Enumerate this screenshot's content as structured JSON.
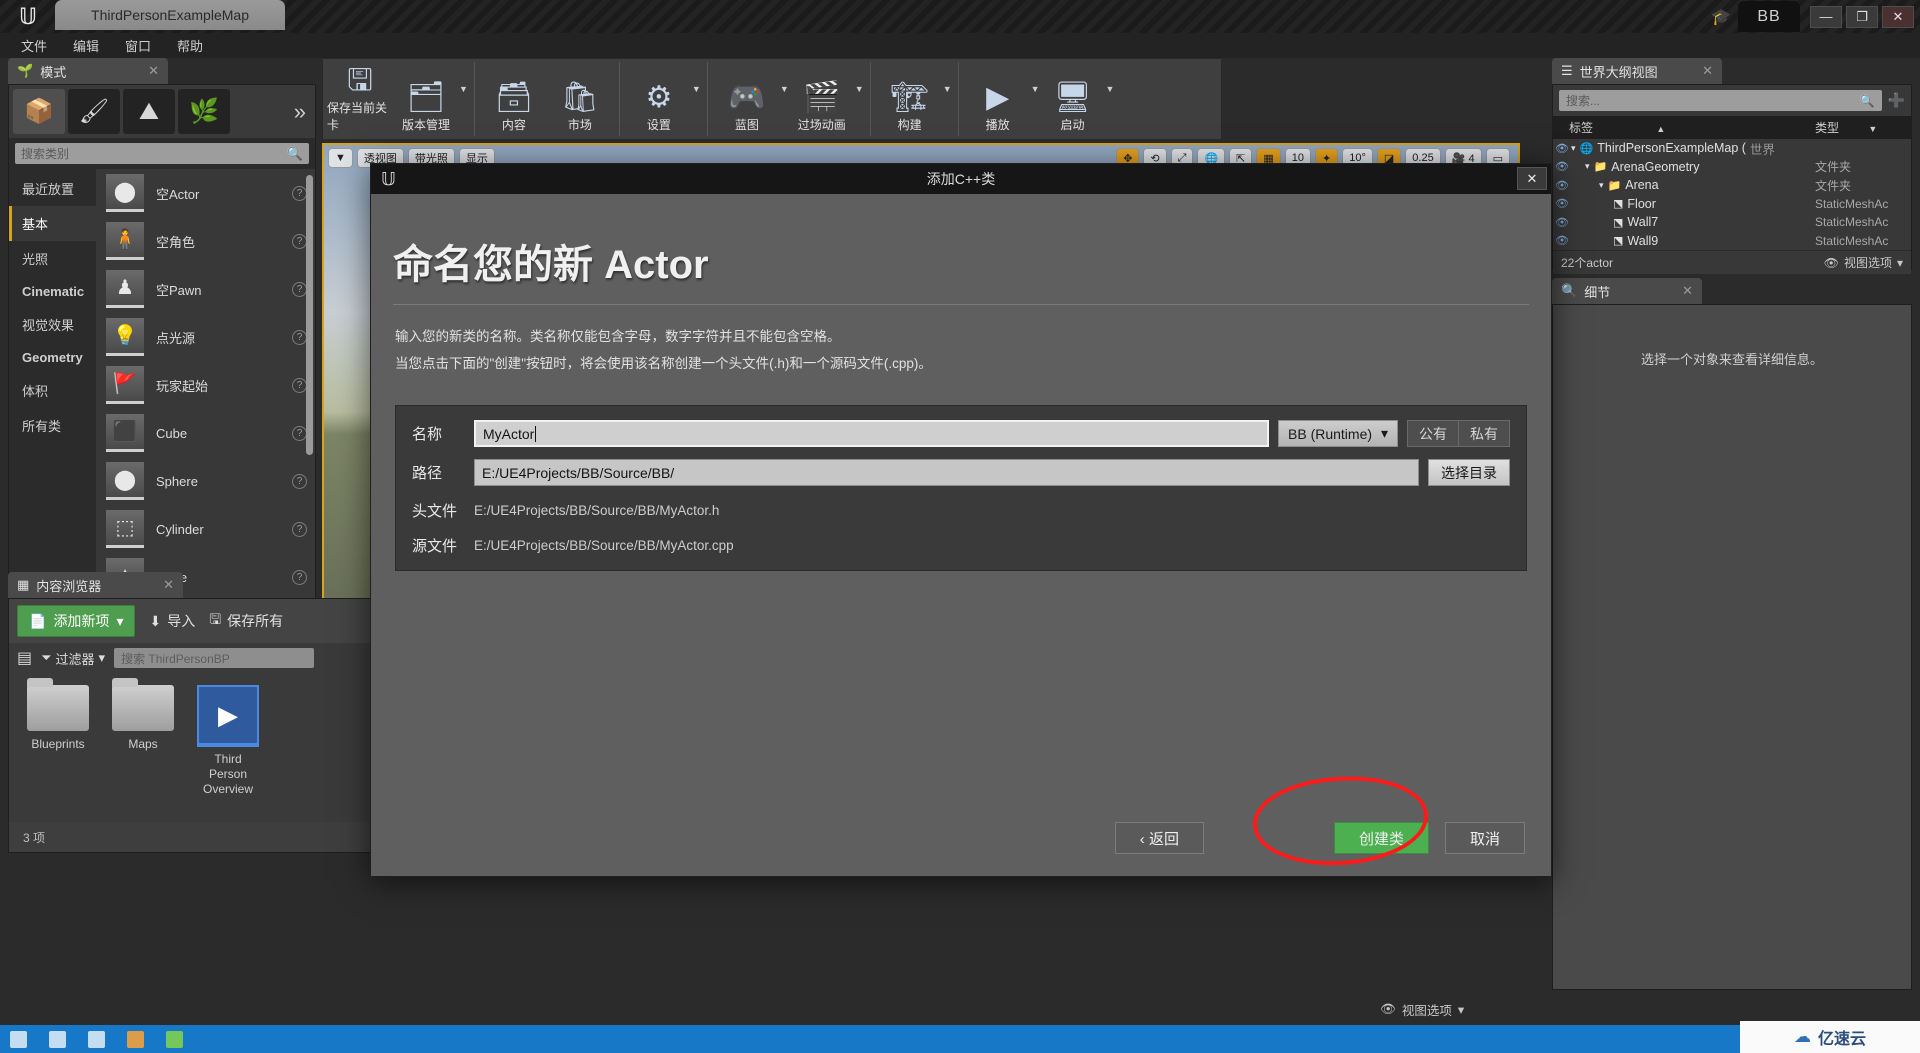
{
  "titlebar": {
    "logo": "ue-logo",
    "map_tab": "ThirdPersonExampleMap",
    "project_badge": "BB",
    "minimize": "—",
    "maximize": "❐",
    "close": "✕"
  },
  "menubar": {
    "items": [
      {
        "label": "文件"
      },
      {
        "label": "编辑"
      },
      {
        "label": "窗口"
      },
      {
        "label": "帮助"
      }
    ]
  },
  "toolbar": {
    "groups": [
      {
        "items": [
          {
            "label": "保存当前关卡",
            "icon": "save-icon",
            "glyph": "🖫",
            "caret": false
          },
          {
            "label": "版本管理",
            "icon": "source-control-icon",
            "glyph": "🗂",
            "caret": true
          }
        ]
      },
      {
        "items": [
          {
            "label": "内容",
            "icon": "content-icon",
            "glyph": "🗃",
            "caret": false
          },
          {
            "label": "市场",
            "icon": "marketplace-icon",
            "glyph": "🛍",
            "caret": false
          }
        ]
      },
      {
        "items": [
          {
            "label": "设置",
            "icon": "settings-gear-icon",
            "glyph": "⚙",
            "caret": true
          }
        ]
      },
      {
        "items": [
          {
            "label": "蓝图",
            "icon": "blueprint-icon",
            "glyph": "🎮",
            "caret": true
          },
          {
            "label": "过场动画",
            "icon": "cinematics-icon",
            "glyph": "🎬",
            "caret": true
          }
        ]
      },
      {
        "items": [
          {
            "label": "构建",
            "icon": "build-icon",
            "glyph": "🏗",
            "caret": true
          }
        ]
      },
      {
        "items": [
          {
            "label": "播放",
            "icon": "play-icon",
            "glyph": "▶",
            "caret": true
          },
          {
            "label": "启动",
            "icon": "launch-icon",
            "glyph": "🖥",
            "caret": true
          }
        ]
      }
    ]
  },
  "viewport": {
    "chips": [
      {
        "name": "viewport-menu",
        "label": "▼"
      },
      {
        "name": "perspective",
        "label": "透视图"
      },
      {
        "name": "lighting",
        "label": "带光照"
      },
      {
        "name": "show",
        "label": "显示"
      }
    ],
    "right_chips": [
      {
        "name": "translate-mode",
        "label": "✥",
        "active": true
      },
      {
        "name": "rotate-mode",
        "label": "⟲",
        "active": false
      },
      {
        "name": "scale-mode",
        "label": "⤢",
        "active": false
      },
      {
        "name": "coord-system",
        "label": "🌐",
        "active": false
      },
      {
        "name": "surface-snap",
        "label": "⇱",
        "active": false
      },
      {
        "name": "grid-snap",
        "label": "▦",
        "active": true
      },
      {
        "name": "grid-size",
        "label": "10",
        "active": false
      },
      {
        "name": "rotation-snap",
        "label": "✦",
        "active": true
      },
      {
        "name": "rotation-value",
        "label": "10°",
        "active": false
      },
      {
        "name": "scale-snap",
        "label": "◪",
        "active": true
      },
      {
        "name": "scale-value",
        "label": "0.25",
        "active": false
      },
      {
        "name": "camera-speed",
        "label": "🎥 4",
        "active": false
      },
      {
        "name": "maximize-viewport",
        "label": "▭",
        "active": false
      }
    ]
  },
  "modes_panel": {
    "tab_title": "模式",
    "tab_close": "✕",
    "mode_buttons": [
      {
        "name": "place-mode",
        "glyph": "📦",
        "active": true
      },
      {
        "name": "paint-mode",
        "glyph": "🖌",
        "active": false
      },
      {
        "name": "landscape-mode",
        "glyph": "⛰",
        "active": false
      },
      {
        "name": "foliage-mode",
        "glyph": "🌿",
        "active": false
      }
    ],
    "more_glyph": "»",
    "search_placeholder": "搜索类别",
    "search_icon": "🔍",
    "categories": [
      {
        "label": "最近放置",
        "active": false,
        "latin": false
      },
      {
        "label": "基本",
        "active": true,
        "latin": false
      },
      {
        "label": "光照",
        "active": false,
        "latin": false
      },
      {
        "label": "Cinematic",
        "active": false,
        "latin": true
      },
      {
        "label": "视觉效果",
        "active": false,
        "latin": false
      },
      {
        "label": "Geometry",
        "active": false,
        "latin": true
      },
      {
        "label": "体积",
        "active": false,
        "latin": false
      },
      {
        "label": "所有类",
        "active": false,
        "latin": false
      }
    ],
    "assets": [
      {
        "label": "空Actor",
        "glyph": "⬤",
        "help": "?"
      },
      {
        "label": "空角色",
        "glyph": "🧍",
        "help": "?"
      },
      {
        "label": "空Pawn",
        "glyph": "♟",
        "help": "?"
      },
      {
        "label": "点光源",
        "glyph": "💡",
        "help": "?"
      },
      {
        "label": "玩家起始",
        "glyph": "🚩",
        "help": "?"
      },
      {
        "label": "Cube",
        "glyph": "⬛",
        "help": "?"
      },
      {
        "label": "Sphere",
        "glyph": "⬤",
        "help": "?"
      },
      {
        "label": "Cylinder",
        "glyph": "⬚",
        "help": "?"
      },
      {
        "label": "Cone",
        "glyph": "▲",
        "help": "?"
      }
    ]
  },
  "content_browser": {
    "tab_title": "内容浏览器",
    "tab_close": "✕",
    "add_new_label": "添加新项",
    "add_new_icon": "📄",
    "add_new_caret": "▾",
    "import_label": "导入",
    "import_icon": "⬇",
    "save_all_label": "保存所有",
    "save_all_icon": "🖫",
    "sources_icon": "▤",
    "filter_label": "过滤器",
    "filter_icon": "⏷",
    "filter_caret": "▾",
    "search_placeholder": "搜索 ThirdPersonBP",
    "items": [
      {
        "label": "Blueprints",
        "type": "folder"
      },
      {
        "label": "Maps",
        "type": "folder"
      },
      {
        "label": "Third\nPerson\nOverview",
        "type": "asset",
        "glyph": "▶",
        "selected": true
      }
    ],
    "status": "3 项",
    "view_options_label": "视图选项",
    "view_options_icon": "👁",
    "view_options_caret": "▾"
  },
  "outliner": {
    "tab_title": "世界大纲视图",
    "tab_close": "✕",
    "tab_icon": "☰",
    "search_placeholder": "搜索...",
    "search_icon": "🔍",
    "add_icon": "➕",
    "columns": {
      "label": "标签",
      "type": "类型",
      "sort_asc": "▲",
      "sort_menu": "▼"
    },
    "rows": [
      {
        "label": "ThirdPersonExampleMap (",
        "suffix": "世界",
        "type": "",
        "indent": 0,
        "icon": "🌐",
        "arrow": "▾",
        "eye": "👁"
      },
      {
        "label": "ArenaGeometry",
        "suffix": "",
        "type": "文件夹",
        "indent": 1,
        "icon": "📁",
        "arrow": "▾",
        "eye": "👁"
      },
      {
        "label": "Arena",
        "suffix": "",
        "type": "文件夹",
        "indent": 2,
        "icon": "📁",
        "arrow": "▾",
        "eye": "👁"
      },
      {
        "label": "Floor",
        "suffix": "",
        "type": "StaticMeshAc",
        "indent": 3,
        "icon": "⬔",
        "arrow": "",
        "eye": "👁"
      },
      {
        "label": "Wall7",
        "suffix": "",
        "type": "StaticMeshAc",
        "indent": 3,
        "icon": "⬔",
        "arrow": "",
        "eye": "👁"
      },
      {
        "label": "Wall9",
        "suffix": "",
        "type": "StaticMeshAc",
        "indent": 3,
        "icon": "⬔",
        "arrow": "",
        "eye": "👁"
      }
    ],
    "actor_count": "22个actor",
    "view_options_label": "视图选项",
    "view_options_icon": "👁",
    "view_options_caret": "▾"
  },
  "details": {
    "tab_title": "细节",
    "tab_close": "✕",
    "tab_icon": "🔍",
    "empty_message": "选择一个对象来查看详细信息。"
  },
  "dialog": {
    "window_title": "添加C++类",
    "window_logo": "ue-logo",
    "close_label": "✕",
    "heading": "命名您的新 Actor",
    "description_line1": "输入您的新类的名称。类名称仅能包含字母，数字字符并且不能包含空格。",
    "description_line2": "当您点击下面的\"创建\"按钮时，将会使用该名称创建一个头文件(.h)和一个源码文件(.cpp)。",
    "name_label": "名称",
    "name_value": "MyActor",
    "module_dropdown": "BB (Runtime)",
    "module_caret": "▾",
    "public_label": "公有",
    "private_label": "私有",
    "path_label": "路径",
    "path_value": "E:/UE4Projects/BB/Source/BB/",
    "choose_dir_label": "选择目录",
    "header_file_label": "头文件",
    "header_file_value": "E:/UE4Projects/BB/Source/BB/MyActor.h",
    "source_file_label": "源文件",
    "source_file_value": "E:/UE4Projects/BB/Source/BB/MyActor.cpp",
    "back_label": "‹ 返回",
    "create_label": "创建类",
    "cancel_label": "取消"
  },
  "watermark": {
    "text": "亿速云",
    "icon": "☁"
  }
}
